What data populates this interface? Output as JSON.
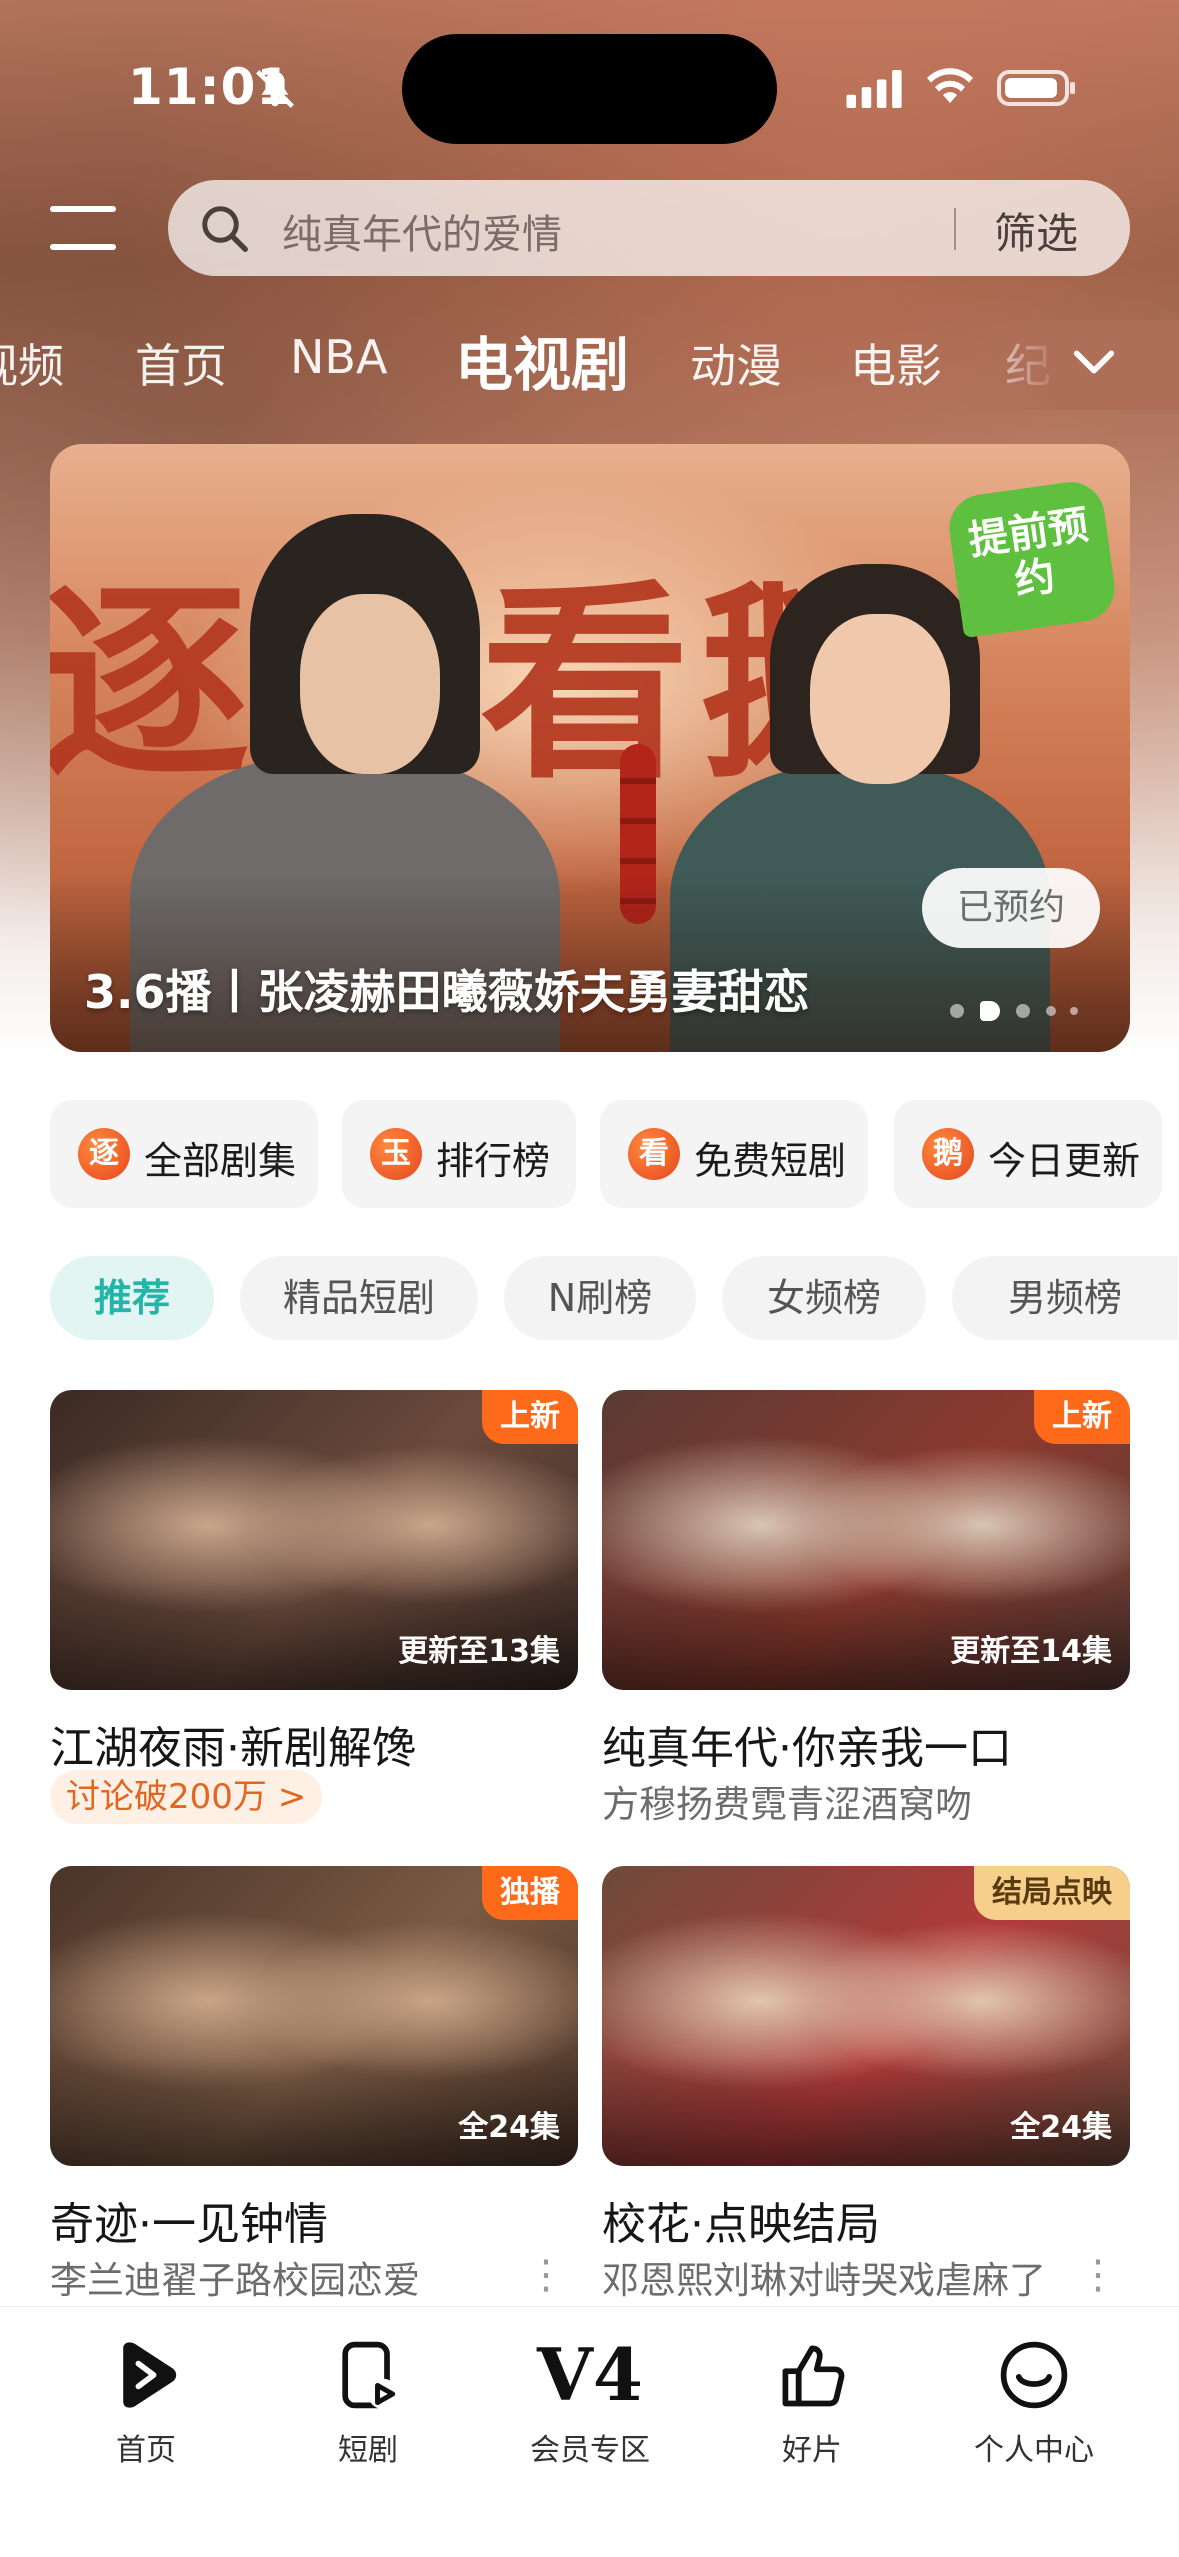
{
  "status_bar": {
    "time": "11:01"
  },
  "search": {
    "placeholder": "纯真年代的爱情",
    "filter_label": "筛选"
  },
  "tabs": [
    {
      "label": "视频"
    },
    {
      "label": "首页"
    },
    {
      "label": "NBA"
    },
    {
      "label": "电视剧",
      "active": true
    },
    {
      "label": "动漫"
    },
    {
      "label": "电影"
    },
    {
      "label": "纪"
    }
  ],
  "banner": {
    "title_art": "逐玉看鹅",
    "badge": "提前预约",
    "booked_button": "已预约",
    "caption": "3.6播丨张凌赫田曦薇娇夫勇妻甜恋",
    "slide_count": 5,
    "active_slide": 2
  },
  "quick_links": [
    {
      "icon_char": "逐",
      "label": "全部剧集"
    },
    {
      "icon_char": "玉",
      "label": "排行榜"
    },
    {
      "icon_char": "看",
      "label": "免费短剧"
    },
    {
      "icon_char": "鹅",
      "label": "今日更新"
    }
  ],
  "chips": [
    {
      "label": "推荐",
      "active": true
    },
    {
      "label": "精品短剧"
    },
    {
      "label": "N刷榜"
    },
    {
      "label": "女频榜"
    },
    {
      "label": "男频榜"
    }
  ],
  "cards": [
    {
      "tag": "上新",
      "episodes": "更新至13集",
      "title": "江湖夜雨·新剧解馋",
      "pill": "讨论破200万 >",
      "colors": [
        "#3b2a24",
        "#c9a58a",
        "#6b4b3d"
      ]
    },
    {
      "tag": "上新",
      "episodes": "更新至14集",
      "title": "纯真年代·你亲我一口",
      "subtitle": "方穆扬费霓青涩酒窝吻",
      "colors": [
        "#5a3a34",
        "#d8c4b2",
        "#8c3a2e"
      ]
    },
    {
      "tag": "独播",
      "episodes": "全24集",
      "title": "奇迹·一见钟情",
      "subtitle": "李兰迪翟子路校园恋爱",
      "more": "⋮",
      "colors": [
        "#4a3428",
        "#caa486",
        "#7a5a44"
      ]
    },
    {
      "tag": "结局点映",
      "episodes": "全24集",
      "title": "校花·点映结局",
      "subtitle": "邓恩熙刘琳对峙哭戏虐麻了",
      "more": "⋮",
      "colors": [
        "#6d4a3a",
        "#e1c5ad",
        "#b23a3a"
      ]
    }
  ],
  "bottom_nav": [
    {
      "icon": "play-logo-icon",
      "label": "首页"
    },
    {
      "icon": "short-drama-icon",
      "label": "短剧"
    },
    {
      "icon": "vip-v4-icon",
      "glyph": "V4",
      "label": "会员专区"
    },
    {
      "icon": "thumbs-up-icon",
      "label": "好片"
    },
    {
      "icon": "smile-face-icon",
      "label": "个人中心"
    }
  ]
}
